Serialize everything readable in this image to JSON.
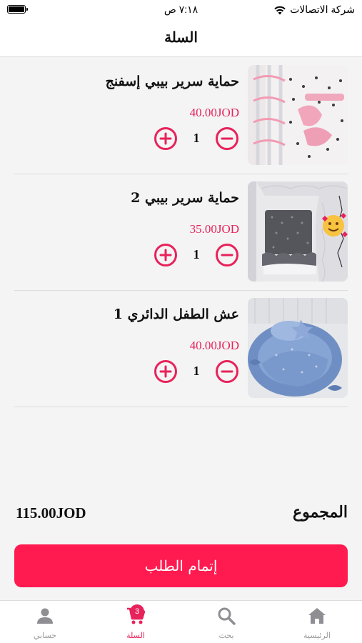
{
  "status_bar": {
    "time": "٧:١٨ ص",
    "carrier": "شركة الاتصالات",
    "battery_level": 1.0
  },
  "header": {
    "title": "السلة"
  },
  "cart": {
    "items": [
      {
        "title": "حماية سرير بيبي إسفنج",
        "price": "40.00JOD",
        "quantity": "1",
        "image_icon": "pink-crib-bumper-photo"
      },
      {
        "title": "حماية سرير بيبي 2",
        "price": "35.00JOD",
        "quantity": "1",
        "image_icon": "grey-crib-bumper-photo"
      },
      {
        "title": "عش الطفل الدائري 1",
        "price": "40.00JOD",
        "quantity": "1",
        "image_icon": "blue-baby-nest-photo"
      }
    ],
    "total_label": "المجموع",
    "total_value": "115.00JOD",
    "checkout_label": "إتمام الطلب"
  },
  "tab_bar": {
    "tabs": [
      {
        "label": "الرئيسية",
        "icon": "home-icon"
      },
      {
        "label": "بحث",
        "icon": "search-icon"
      },
      {
        "label": "السلة",
        "icon": "cart-icon",
        "badge": "3",
        "active": true
      },
      {
        "label": "حسابي",
        "icon": "person-icon"
      }
    ]
  },
  "colors": {
    "accent": "#e8225a",
    "button": "#ff1a4f",
    "background": "#f4f4f4"
  }
}
